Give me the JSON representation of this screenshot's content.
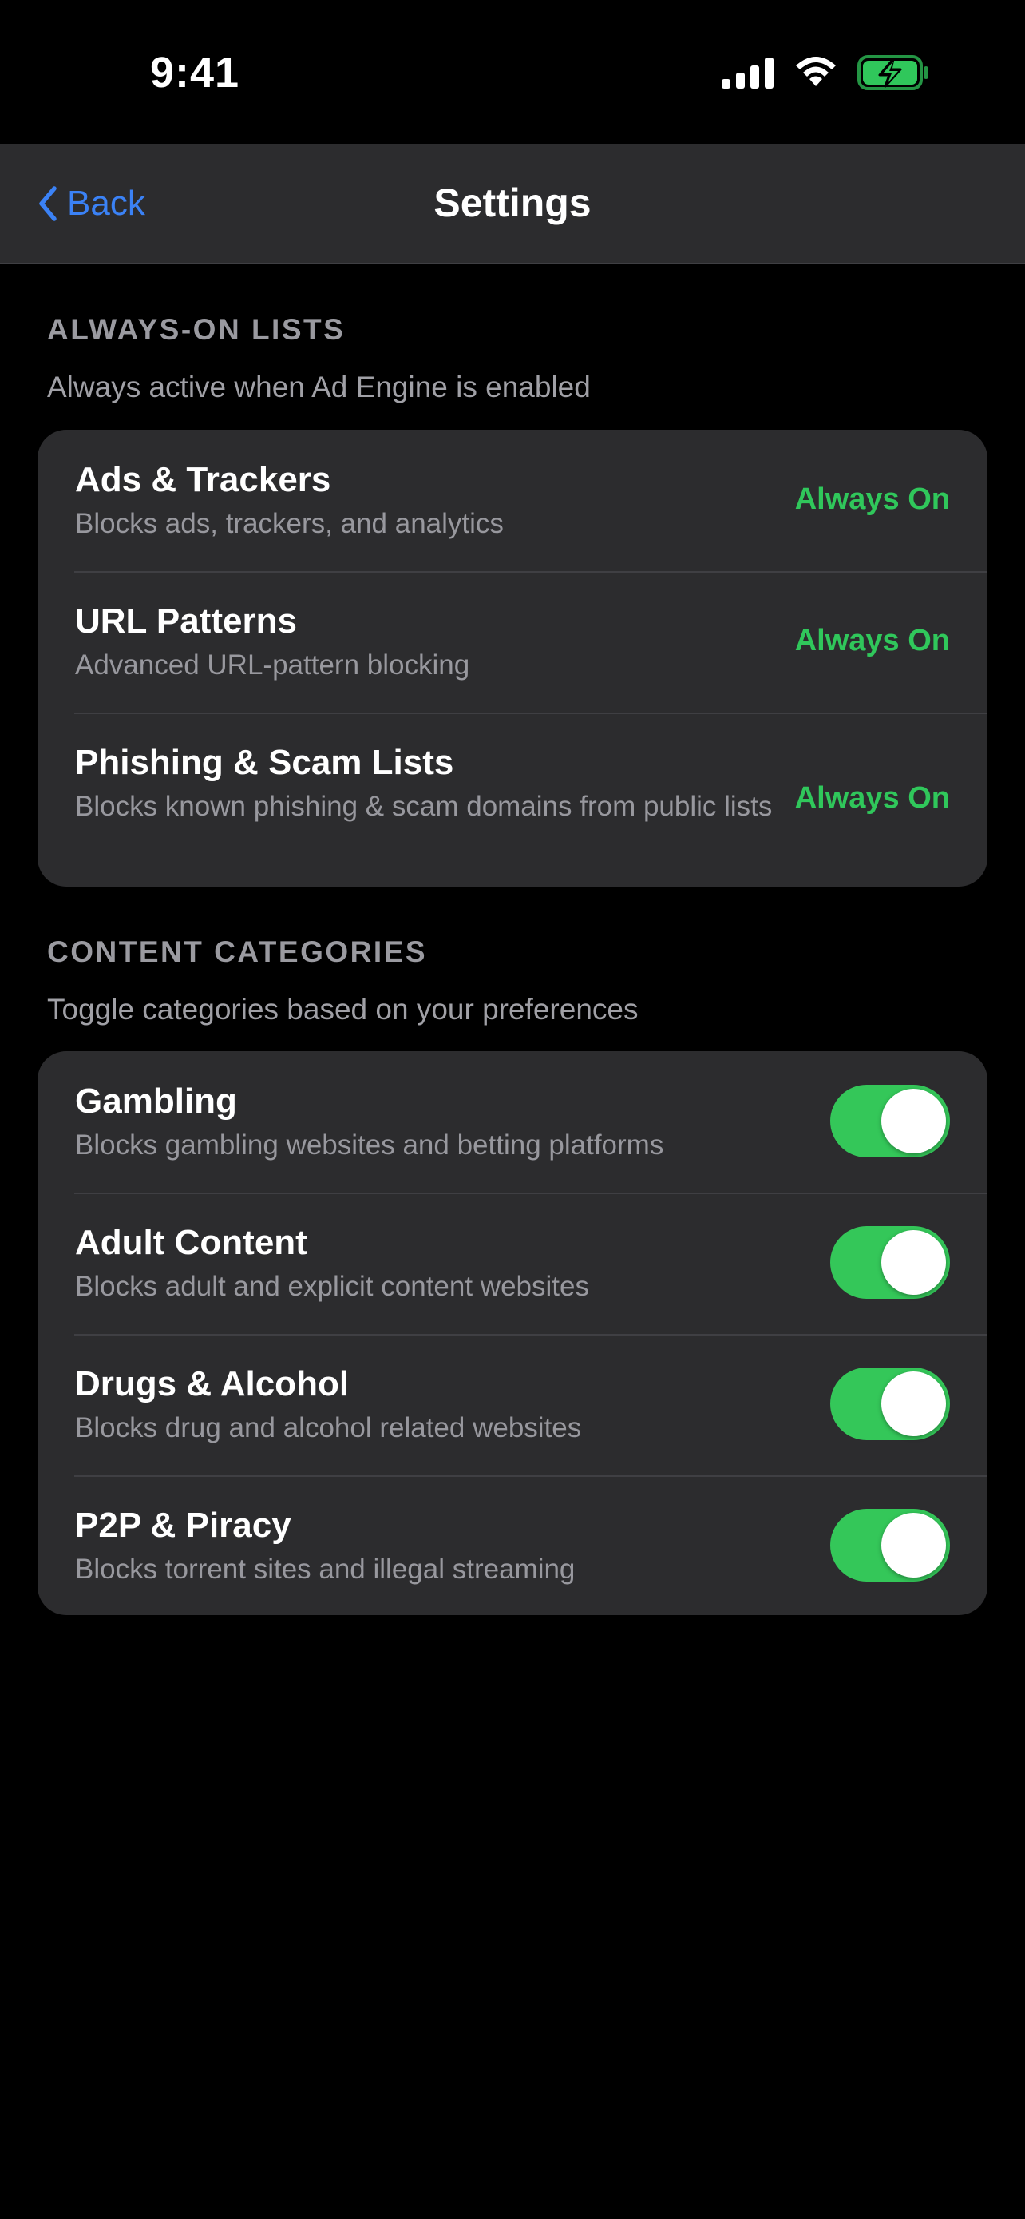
{
  "status_bar": {
    "time": "9:41",
    "icons": [
      "cellular-signal-icon",
      "wifi-icon",
      "battery-charging-icon"
    ]
  },
  "nav": {
    "back_label": "Back",
    "back_icon": "chevron-left-icon",
    "title": "Settings"
  },
  "colors": {
    "accent_blue": "#3b82f6",
    "status_green": "#30c75b",
    "toggle_on": "#34c759",
    "card_background": "#2c2c2e",
    "page_background": "#000000"
  },
  "always_on": {
    "header": "ALWAYS-ON LISTS",
    "subtitle": "Always active when Ad Engine is enabled",
    "items": [
      {
        "title": "Ads & Trackers",
        "description": "Blocks ads, trackers, and analytics",
        "status": "Always On"
      },
      {
        "title": "URL Patterns",
        "description": "Advanced URL-pattern blocking",
        "status": "Always On"
      },
      {
        "title": "Phishing & Scam Lists",
        "description": "Blocks known phishing & scam domains from public lists",
        "status": "Always On"
      }
    ]
  },
  "categories": {
    "header": "CONTENT CATEGORIES",
    "subtitle": "Toggle categories based on your preferences",
    "items": [
      {
        "title": "Gambling",
        "description": "Blocks gambling websites and betting platforms",
        "enabled": true
      },
      {
        "title": "Adult Content",
        "description": "Blocks adult and explicit content websites",
        "enabled": true
      },
      {
        "title": "Drugs & Alcohol",
        "description": "Blocks drug and alcohol related websites",
        "enabled": true
      },
      {
        "title": "P2P & Piracy",
        "description": "Blocks torrent sites and illegal streaming",
        "enabled": true
      }
    ]
  }
}
